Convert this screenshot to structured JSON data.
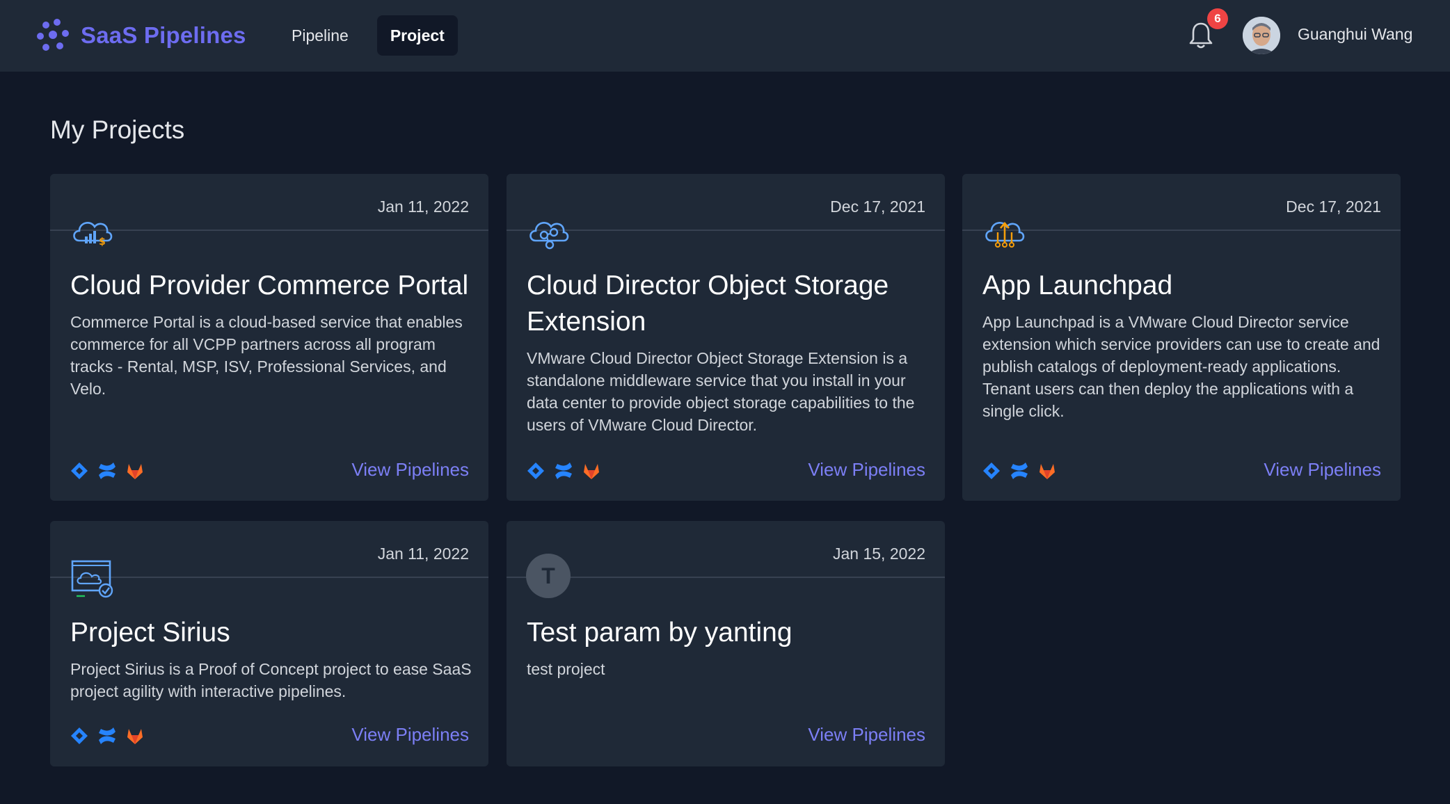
{
  "brand": {
    "name": "SaaS Pipelines",
    "accent": "#6d6cf0"
  },
  "nav": {
    "tabs": [
      {
        "label": "Pipeline",
        "active": false
      },
      {
        "label": "Project",
        "active": true
      }
    ]
  },
  "header": {
    "notification_count": "6",
    "user_name": "Guanghui Wang"
  },
  "page": {
    "title": "My Projects"
  },
  "projects": [
    {
      "date": "Jan 11, 2022",
      "icon": "cloud-commerce-icon",
      "title": "Cloud Provider Commerce Portal",
      "description": "Commerce Portal is a cloud-based service that enables commerce for all VCPP partners across all program tracks - Rental, MSP, ISV, Professional Services, and Velo.",
      "tools": [
        "jira-icon",
        "confluence-icon",
        "gitlab-icon"
      ],
      "link": "View Pipelines"
    },
    {
      "date": "Dec 17, 2021",
      "icon": "cloud-storage-icon",
      "title": "Cloud Director Object Storage Extension",
      "description": "VMware Cloud Director Object Storage Extension is a standalone middleware service that you install in your data center to provide object storage capabilities to the users of VMware Cloud Director.",
      "tools": [
        "jira-icon",
        "confluence-icon",
        "gitlab-icon"
      ],
      "link": "View Pipelines"
    },
    {
      "date": "Dec 17, 2021",
      "icon": "cloud-launch-icon",
      "title": "App Launchpad",
      "description": "App Launchpad is a VMware Cloud Director service extension which service providers can use to create and publish catalogs of deployment-ready applications. Tenant users can then deploy the applications with a single click.",
      "tools": [
        "jira-icon",
        "confluence-icon",
        "gitlab-icon"
      ],
      "link": "View Pipelines"
    },
    {
      "date": "Jan 11, 2022",
      "icon": "monitor-cloud-check-icon",
      "title": "Project Sirius",
      "description": "Project Sirius is a Proof of Concept project to ease SaaS project agility with interactive pipelines.",
      "tools": [
        "jira-icon",
        "confluence-icon",
        "gitlab-icon"
      ],
      "link": "View Pipelines"
    },
    {
      "date": "Jan 15, 2022",
      "icon_letter": "T",
      "title": "Test param by yanting",
      "description": "test project",
      "tools": [],
      "link": "View Pipelines"
    }
  ]
}
